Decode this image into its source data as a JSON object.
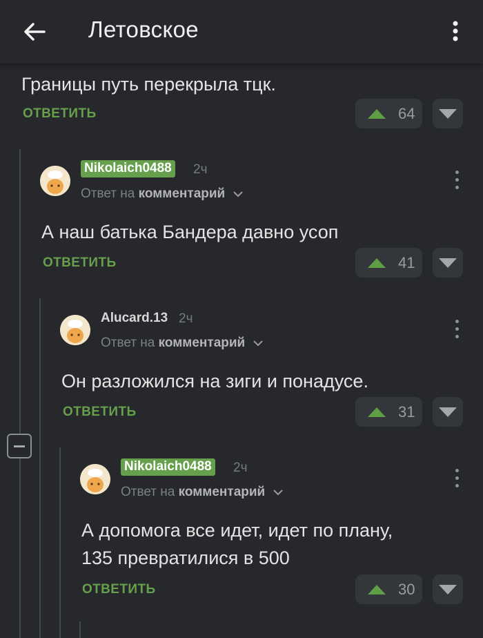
{
  "header": {
    "title": "Летовское"
  },
  "top_comment": {
    "text": "Границы путь перекрыла тцк.",
    "reply_label": "ОТВЕТИТЬ",
    "votes": "64"
  },
  "comments": [
    {
      "username": "Nikolaich0488",
      "time": "2ч",
      "reply_to_prefix": "Ответ на",
      "reply_to_target": "комментарий",
      "text": "А наш батька Бандера давно усоп",
      "reply_label": "ОТВЕТИТЬ",
      "votes": "41"
    },
    {
      "username": "Alucard.13",
      "time": "2ч",
      "reply_to_prefix": "Ответ на",
      "reply_to_target": "комментарий",
      "text": "Он разложился на зиги и понадусе.",
      "reply_label": "ОТВЕТИТЬ",
      "votes": "31"
    },
    {
      "username": "Nikolaich0488",
      "time": "2ч",
      "reply_to_prefix": "Ответ на",
      "reply_to_target": "комментарий",
      "text_line1": "А допомога все идет, идет по плану,",
      "text_line2": "135 превратилися в 500",
      "reply_label": "ОТВЕТИТЬ",
      "votes": "30"
    }
  ],
  "colors": {
    "background": "#26282c",
    "accent_green": "#66a04c",
    "vote_bg": "#33363b"
  }
}
